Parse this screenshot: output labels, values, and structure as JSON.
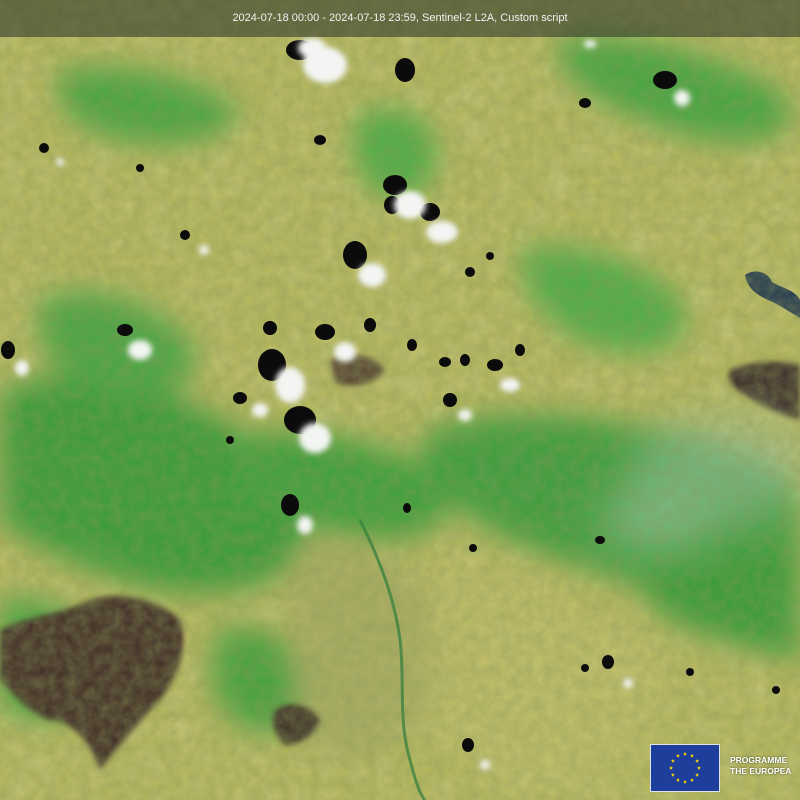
{
  "header": {
    "caption": "2024-07-18 00:00 - 2024-07-18 23:59, Sentinel-2 L2A, Custom script"
  },
  "logo": {
    "icon": "eu-flag-icon",
    "line1": "PROGRAMME",
    "line2": "THE EUROPEA"
  },
  "colors": {
    "cropland": "#c9c06a",
    "vegetation": "#3aa83a",
    "forest": "#1f8a2e",
    "burn_scar": "#3a2a26",
    "cloud": "#f4f6f4",
    "cloud_shadow": "#0a0a0a",
    "water": "#1f3350",
    "eu_blue": "#1e3e9c",
    "eu_star": "#ffd200"
  }
}
